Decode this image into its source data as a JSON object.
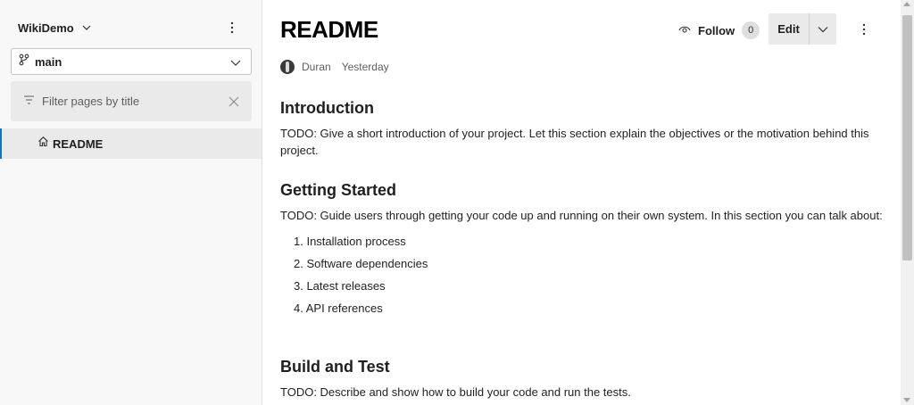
{
  "sidebar": {
    "wiki_name": "WikiDemo",
    "branch": "main",
    "filter": {
      "placeholder": "Filter pages by title",
      "value": ""
    },
    "pages": [
      {
        "label": "README"
      }
    ]
  },
  "header": {
    "title": "README",
    "follow_label": "Follow",
    "follow_count": "0",
    "edit_label": "Edit"
  },
  "meta": {
    "author": "Duran",
    "date": "Yesterday"
  },
  "content": {
    "sections": [
      {
        "heading": "Introduction",
        "text": "TODO: Give a short introduction of your project. Let this section explain the objectives or the motivation behind this project."
      },
      {
        "heading": "Getting Started",
        "text": "TODO: Guide users through getting your code up and running on their own system. In this section you can talk about:",
        "list": [
          "1. Installation process",
          "2. Software dependencies",
          "3. Latest releases",
          "4. API references"
        ]
      },
      {
        "heading": "Build and Test",
        "text": "TODO: Describe and show how to build your code and run the tests."
      }
    ]
  },
  "colors": {
    "accent": "#0078d4",
    "sidebar_bg": "#f8f8f8",
    "selected_bg": "#eaeaea"
  },
  "icons": [
    "chevron-down-icon",
    "more-vertical-icon",
    "branch-icon",
    "filter-icon",
    "close-icon",
    "home-icon",
    "eye-icon"
  ]
}
